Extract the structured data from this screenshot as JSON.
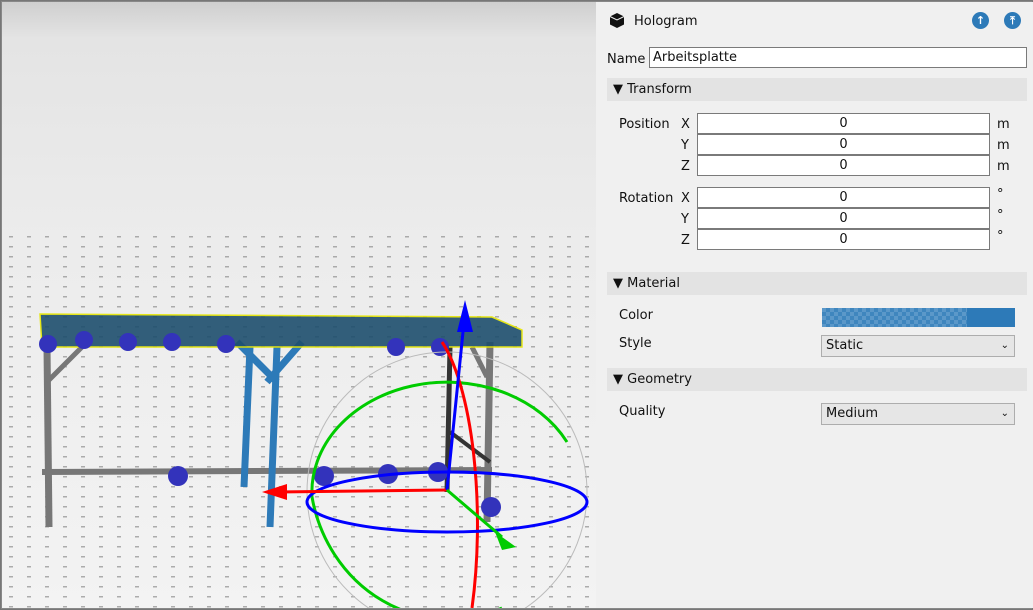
{
  "panel": {
    "title": "Hologram",
    "icon": "cube-icon",
    "buttons": [
      {
        "icon": "arrow-up-circle-icon"
      },
      {
        "icon": "arrow-to-top-circle-icon"
      }
    ],
    "name_label": "Name",
    "name_value": "Arbeitsplatte",
    "transform": {
      "header": "Transform",
      "position_label": "Position",
      "rotation_label": "Rotation",
      "position": [
        {
          "axis": "X",
          "value": "0",
          "unit": "m"
        },
        {
          "axis": "Y",
          "value": "0",
          "unit": "m"
        },
        {
          "axis": "Z",
          "value": "0",
          "unit": "m"
        }
      ],
      "rotation": [
        {
          "axis": "X",
          "value": "0",
          "unit": "°"
        },
        {
          "axis": "Y",
          "value": "0",
          "unit": "°"
        },
        {
          "axis": "Z",
          "value": "0",
          "unit": "°"
        }
      ]
    },
    "material": {
      "header": "Material",
      "color_label": "Color",
      "color": "#2d7ab8",
      "style_label": "Style",
      "style_value": "Static"
    },
    "geometry": {
      "header": "Geometry",
      "quality_label": "Quality",
      "quality_value": "Medium"
    }
  },
  "colors": {
    "accent": "#2d7ab8",
    "gizmo_x": "#ff0000",
    "gizmo_y": "#00cc00",
    "gizmo_z": "#0000ff",
    "selection": "#ffff00"
  }
}
